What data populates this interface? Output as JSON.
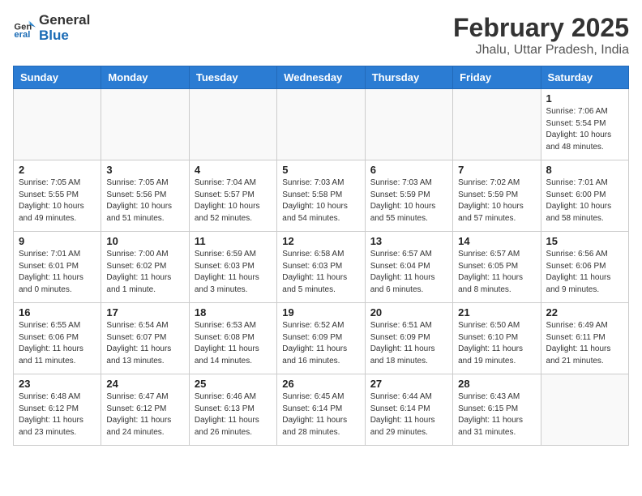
{
  "header": {
    "logo": {
      "general": "General",
      "blue": "Blue"
    },
    "month": "February 2025",
    "location": "Jhalu, Uttar Pradesh, India"
  },
  "weekdays": [
    "Sunday",
    "Monday",
    "Tuesday",
    "Wednesday",
    "Thursday",
    "Friday",
    "Saturday"
  ],
  "weeks": [
    [
      {
        "day": null
      },
      {
        "day": null
      },
      {
        "day": null
      },
      {
        "day": null
      },
      {
        "day": null
      },
      {
        "day": null
      },
      {
        "day": 1,
        "sunrise": "7:06 AM",
        "sunset": "5:54 PM",
        "daylight": "10 hours and 48 minutes."
      }
    ],
    [
      {
        "day": 2,
        "sunrise": "7:05 AM",
        "sunset": "5:55 PM",
        "daylight": "10 hours and 49 minutes."
      },
      {
        "day": 3,
        "sunrise": "7:05 AM",
        "sunset": "5:56 PM",
        "daylight": "10 hours and 51 minutes."
      },
      {
        "day": 4,
        "sunrise": "7:04 AM",
        "sunset": "5:57 PM",
        "daylight": "10 hours and 52 minutes."
      },
      {
        "day": 5,
        "sunrise": "7:03 AM",
        "sunset": "5:58 PM",
        "daylight": "10 hours and 54 minutes."
      },
      {
        "day": 6,
        "sunrise": "7:03 AM",
        "sunset": "5:59 PM",
        "daylight": "10 hours and 55 minutes."
      },
      {
        "day": 7,
        "sunrise": "7:02 AM",
        "sunset": "5:59 PM",
        "daylight": "10 hours and 57 minutes."
      },
      {
        "day": 8,
        "sunrise": "7:01 AM",
        "sunset": "6:00 PM",
        "daylight": "10 hours and 58 minutes."
      }
    ],
    [
      {
        "day": 9,
        "sunrise": "7:01 AM",
        "sunset": "6:01 PM",
        "daylight": "11 hours and 0 minutes."
      },
      {
        "day": 10,
        "sunrise": "7:00 AM",
        "sunset": "6:02 PM",
        "daylight": "11 hours and 1 minute."
      },
      {
        "day": 11,
        "sunrise": "6:59 AM",
        "sunset": "6:03 PM",
        "daylight": "11 hours and 3 minutes."
      },
      {
        "day": 12,
        "sunrise": "6:58 AM",
        "sunset": "6:03 PM",
        "daylight": "11 hours and 5 minutes."
      },
      {
        "day": 13,
        "sunrise": "6:57 AM",
        "sunset": "6:04 PM",
        "daylight": "11 hours and 6 minutes."
      },
      {
        "day": 14,
        "sunrise": "6:57 AM",
        "sunset": "6:05 PM",
        "daylight": "11 hours and 8 minutes."
      },
      {
        "day": 15,
        "sunrise": "6:56 AM",
        "sunset": "6:06 PM",
        "daylight": "11 hours and 9 minutes."
      }
    ],
    [
      {
        "day": 16,
        "sunrise": "6:55 AM",
        "sunset": "6:06 PM",
        "daylight": "11 hours and 11 minutes."
      },
      {
        "day": 17,
        "sunrise": "6:54 AM",
        "sunset": "6:07 PM",
        "daylight": "11 hours and 13 minutes."
      },
      {
        "day": 18,
        "sunrise": "6:53 AM",
        "sunset": "6:08 PM",
        "daylight": "11 hours and 14 minutes."
      },
      {
        "day": 19,
        "sunrise": "6:52 AM",
        "sunset": "6:09 PM",
        "daylight": "11 hours and 16 minutes."
      },
      {
        "day": 20,
        "sunrise": "6:51 AM",
        "sunset": "6:09 PM",
        "daylight": "11 hours and 18 minutes."
      },
      {
        "day": 21,
        "sunrise": "6:50 AM",
        "sunset": "6:10 PM",
        "daylight": "11 hours and 19 minutes."
      },
      {
        "day": 22,
        "sunrise": "6:49 AM",
        "sunset": "6:11 PM",
        "daylight": "11 hours and 21 minutes."
      }
    ],
    [
      {
        "day": 23,
        "sunrise": "6:48 AM",
        "sunset": "6:12 PM",
        "daylight": "11 hours and 23 minutes."
      },
      {
        "day": 24,
        "sunrise": "6:47 AM",
        "sunset": "6:12 PM",
        "daylight": "11 hours and 24 minutes."
      },
      {
        "day": 25,
        "sunrise": "6:46 AM",
        "sunset": "6:13 PM",
        "daylight": "11 hours and 26 minutes."
      },
      {
        "day": 26,
        "sunrise": "6:45 AM",
        "sunset": "6:14 PM",
        "daylight": "11 hours and 28 minutes."
      },
      {
        "day": 27,
        "sunrise": "6:44 AM",
        "sunset": "6:14 PM",
        "daylight": "11 hours and 29 minutes."
      },
      {
        "day": 28,
        "sunrise": "6:43 AM",
        "sunset": "6:15 PM",
        "daylight": "11 hours and 31 minutes."
      },
      {
        "day": null
      }
    ]
  ]
}
